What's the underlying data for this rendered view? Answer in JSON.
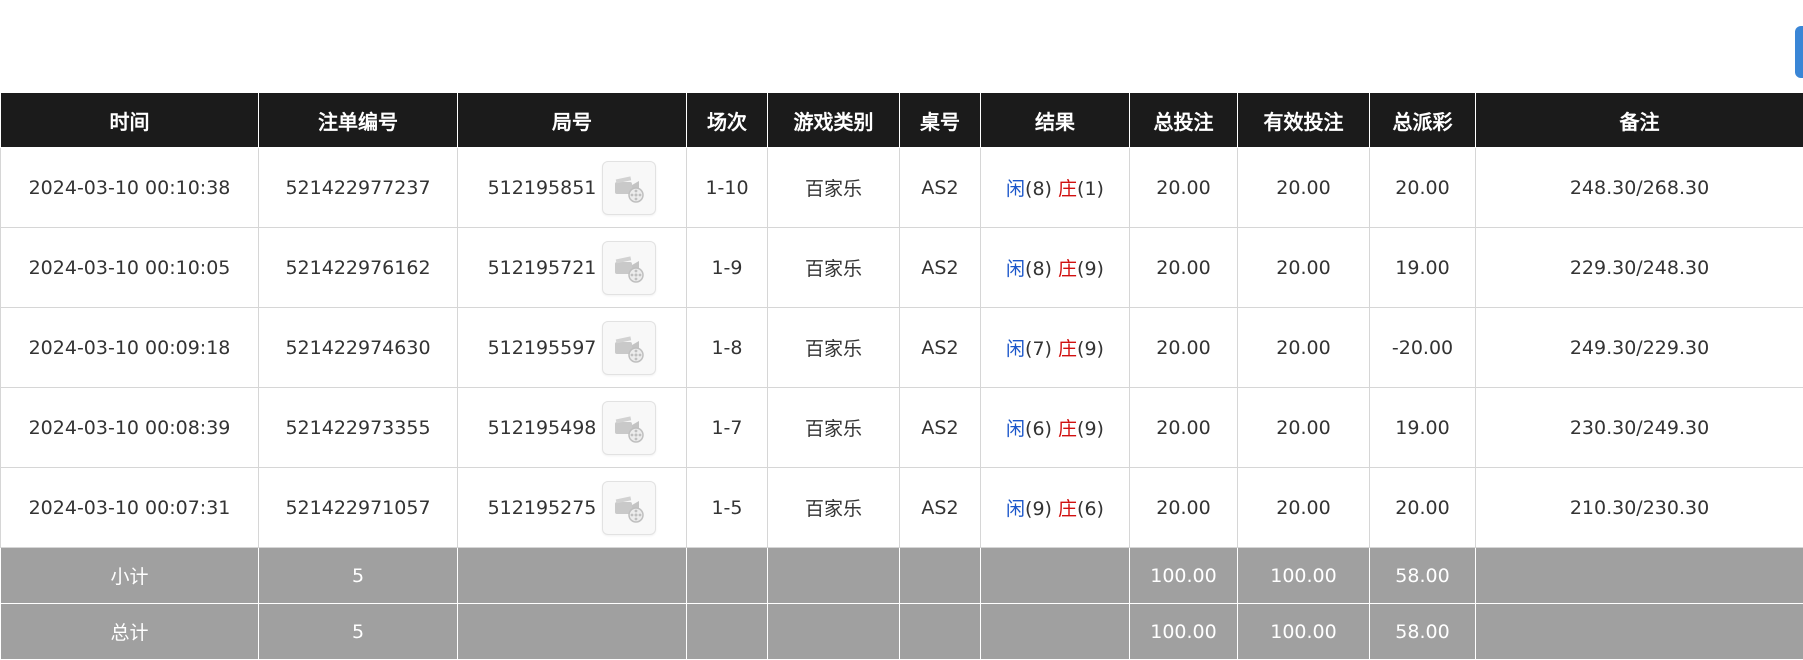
{
  "table": {
    "headers": [
      "时间",
      "注单编号",
      "局号",
      "场次",
      "游戏类别",
      "桌号",
      "结果",
      "总投注",
      "有效投注",
      "总派彩",
      "备注"
    ],
    "rows": [
      {
        "time": "2024-03-10 00:10:38",
        "bet_id": "521422977237",
        "round": "512195851",
        "session": "1-10",
        "game": "百家乐",
        "table": "AS2",
        "player_label": "闲",
        "player_score": "(8)",
        "banker_label": "庄",
        "banker_score": "(1)",
        "total_bet": "20.00",
        "valid_bet": "20.00",
        "payout": "20.00",
        "remark": "248.30/268.30"
      },
      {
        "time": "2024-03-10 00:10:05",
        "bet_id": "521422976162",
        "round": "512195721",
        "session": "1-9",
        "game": "百家乐",
        "table": "AS2",
        "player_label": "闲",
        "player_score": "(8)",
        "banker_label": "庄",
        "banker_score": "(9)",
        "total_bet": "20.00",
        "valid_bet": "20.00",
        "payout": "19.00",
        "remark": "229.30/248.30"
      },
      {
        "time": "2024-03-10 00:09:18",
        "bet_id": "521422974630",
        "round": "512195597",
        "session": "1-8",
        "game": "百家乐",
        "table": "AS2",
        "player_label": "闲",
        "player_score": "(7)",
        "banker_label": "庄",
        "banker_score": "(9)",
        "total_bet": "20.00",
        "valid_bet": "20.00",
        "payout": "-20.00",
        "remark": "249.30/229.30"
      },
      {
        "time": "2024-03-10 00:08:39",
        "bet_id": "521422973355",
        "round": "512195498",
        "session": "1-7",
        "game": "百家乐",
        "table": "AS2",
        "player_label": "闲",
        "player_score": "(6)",
        "banker_label": "庄",
        "banker_score": "(9)",
        "total_bet": "20.00",
        "valid_bet": "20.00",
        "payout": "19.00",
        "remark": "230.30/249.30"
      },
      {
        "time": "2024-03-10 00:07:31",
        "bet_id": "521422971057",
        "round": "512195275",
        "session": "1-5",
        "game": "百家乐",
        "table": "AS2",
        "player_label": "闲",
        "player_score": "(9)",
        "banker_label": "庄",
        "banker_score": "(6)",
        "total_bet": "20.00",
        "valid_bet": "20.00",
        "payout": "20.00",
        "remark": "210.30/230.30"
      }
    ],
    "subtotal": {
      "label": "小计",
      "count": "5",
      "total_bet": "100.00",
      "valid_bet": "100.00",
      "payout": "58.00"
    },
    "grand_total": {
      "label": "总计",
      "count": "5",
      "total_bet": "100.00",
      "valid_bet": "100.00",
      "payout": "58.00"
    }
  },
  "colors": {
    "header_bg": "#1b1b1b",
    "footer_bg": "#a0a0a0",
    "player": "#1a55c9",
    "banker": "#d10f0f",
    "negative": "#d10f0f",
    "accent": "#3a86d6"
  },
  "icons": {
    "replay": "video-replay-icon"
  }
}
